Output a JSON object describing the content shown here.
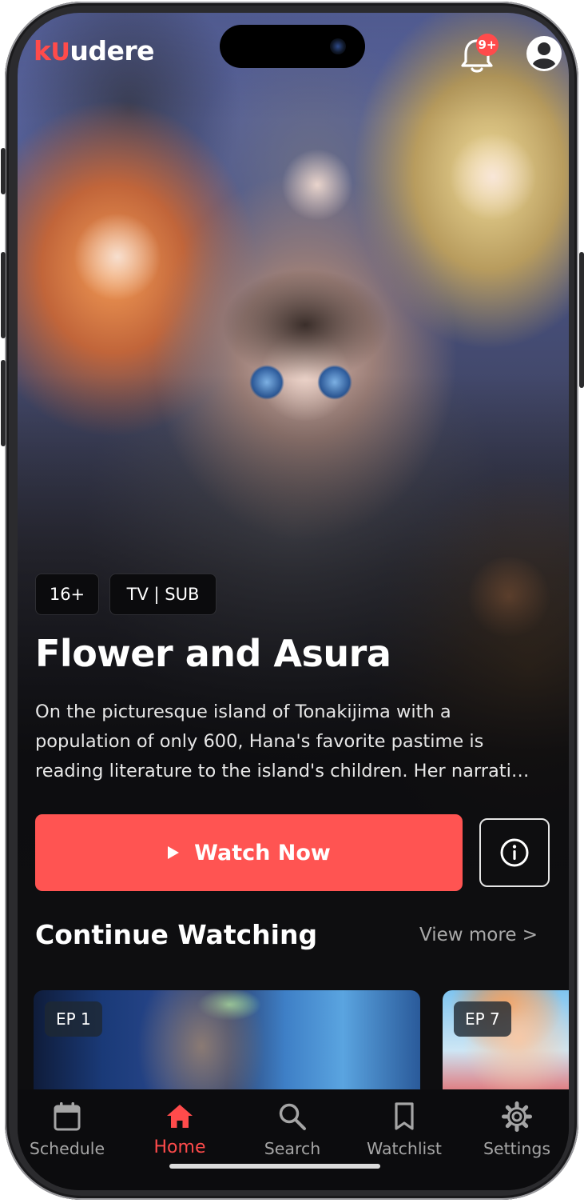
{
  "app": {
    "logo_prefix": "k",
    "logo_mid": "U",
    "logo_suffix": "udere"
  },
  "header": {
    "notification_badge": "9+"
  },
  "featured": {
    "rating": "16+",
    "format": "TV | SUB",
    "title": "Flower and Asura",
    "description_lines": [
      "On the picturesque island of Tonakijima with a",
      "population of only 600, Hana's favorite pastime is",
      "reading literature to the island's children. Her narrati…"
    ],
    "watch_label": "Watch Now"
  },
  "continue_watching": {
    "title": "Continue Watching",
    "view_more": "View more >",
    "items": [
      {
        "episode": "EP 1"
      },
      {
        "episode": "EP 7"
      }
    ]
  },
  "tabbar": {
    "items": [
      {
        "label": "Schedule",
        "icon": "calendar-icon",
        "active": false
      },
      {
        "label": "Home",
        "icon": "home-icon",
        "active": true
      },
      {
        "label": "Search",
        "icon": "search-icon",
        "active": false
      },
      {
        "label": "Watchlist",
        "icon": "bookmark-icon",
        "active": false
      },
      {
        "label": "Settings",
        "icon": "gear-icon",
        "active": false
      }
    ]
  },
  "colors": {
    "accent": "#ff5452",
    "background": "#0e0e10",
    "muted_text": "#a5a5a5"
  }
}
